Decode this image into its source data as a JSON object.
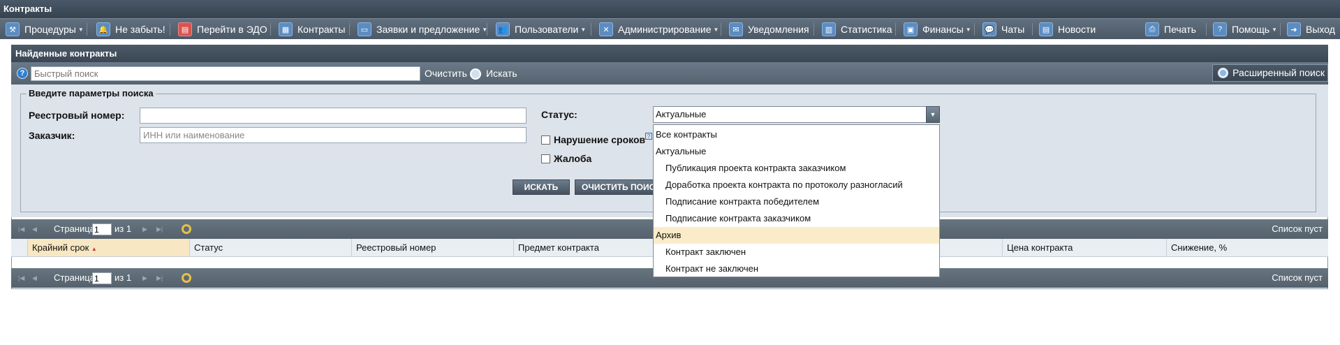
{
  "title": "Контракты",
  "menu": {
    "procedures": "Процедуры",
    "remember": "Не забыть!",
    "edo": "Перейти в ЭДО",
    "contracts": "Контракты",
    "requests": "Заявки и предложение",
    "users": "Пользователи",
    "admin": "Администрирование",
    "notifications": "Уведомления",
    "statistics": "Статистика",
    "finances": "Финансы",
    "chats": "Чаты",
    "news": "Новости",
    "print": "Печать",
    "help": "Помощь",
    "exit": "Выход"
  },
  "panel": {
    "title": "Найденные контракты",
    "quick_search_placeholder": "Быстрый поиск",
    "clear_label": "Очистить",
    "search_label": "Искать",
    "advanced_label": "Расширенный поиск"
  },
  "form": {
    "legend": "Введите параметры поиска",
    "registry_label": "Реестровый номер:",
    "customer_label": "Заказчик:",
    "customer_placeholder": "ИНН или наименование",
    "status_label": "Статус:",
    "status_value": "Актуальные",
    "deadline_violation_label": "Нарушение сроков",
    "complaint_label": "Жалоба",
    "search_button": "ИСКАТЬ",
    "clear_button": "ОЧИСТИТЬ ПОИС"
  },
  "status_options": [
    {
      "label": "Все контракты"
    },
    {
      "label": "Актуальные"
    },
    {
      "label": "Публикация проекта контракта заказчиком"
    },
    {
      "label": "Доработка проекта контракта по протоколу разногласий"
    },
    {
      "label": "Подписание контракта победителем"
    },
    {
      "label": "Подписание контракта заказчиком"
    },
    {
      "label": "Архив"
    },
    {
      "label": "Контракт заключен"
    },
    {
      "label": "Контракт не заключен"
    }
  ],
  "pager": {
    "page_label": "Страница",
    "page_value": "1",
    "of_label": "из 1",
    "empty_label": "Список пуст"
  },
  "columns": {
    "deadline": "Крайний срок",
    "status": "Статус",
    "registry": "Реестровый номер",
    "subject": "Предмет контракта",
    "price": "Цена контракта",
    "decrease": "Снижение, %"
  }
}
